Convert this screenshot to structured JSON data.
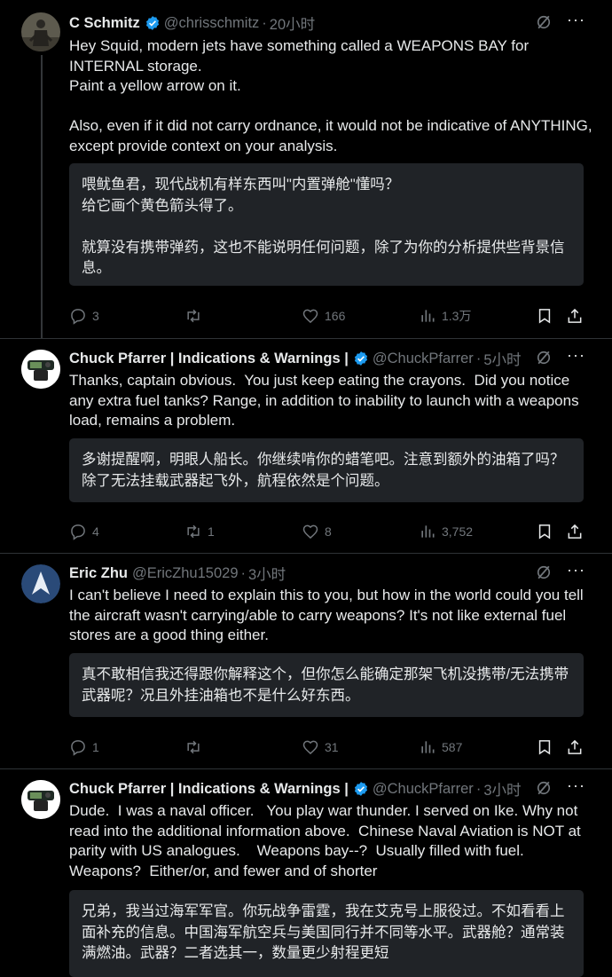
{
  "tweets": [
    {
      "name": "C Schmitz",
      "handle": "@chrisschmitz",
      "time": "20小时",
      "text": "Hey Squid, modern jets have something called a WEAPONS BAY for INTERNAL storage.\nPaint a yellow arrow on it.\n\nAlso, even if it did not carry ordnance, it would not be indicative of ANYTHING, except provide context on your analysis.",
      "translation": "喂鱿鱼君，现代战机有样东西叫\"内置弹舱\"懂吗？\n给它画个黄色箭头得了。\n\n就算没有携带弹药，这也不能说明任何问题，除了为你的分析提供些背景信息。",
      "replies": "3",
      "retweets": "",
      "likes": "166",
      "views": "1.3万"
    },
    {
      "name": "Chuck Pfarrer | Indications & Warnings |",
      "handle": "@ChuckPfarrer",
      "time": "5小时",
      "text": "Thanks, captain obvious.  You just keep eating the crayons.  Did you notice any extra fuel tanks? Range, in addition to inability to launch with a weapons load, remains a problem.",
      "translation": "多谢提醒啊，明眼人船长。你继续啃你的蜡笔吧。注意到额外的油箱了吗？除了无法挂载武器起飞外，航程依然是个问题。",
      "replies": "4",
      "retweets": "1",
      "likes": "8",
      "views": "3,752"
    },
    {
      "name": "Eric Zhu",
      "handle": "@EricZhu15029",
      "time": "3小时",
      "text": "I can't believe I need to explain this to you, but how in the world could you tell the aircraft wasn't carrying/able to carry weapons? It's not like external fuel stores are a good thing either.",
      "translation": "真不敢相信我还得跟你解释这个，但你怎么能确定那架飞机没携带/无法携带武器呢？况且外挂油箱也不是什么好东西。",
      "replies": "1",
      "retweets": "",
      "likes": "31",
      "views": "587"
    },
    {
      "name": "Chuck Pfarrer | Indications & Warnings |",
      "handle": "@ChuckPfarrer",
      "time": "3小时",
      "text": "Dude.  I was a naval officer.   You play war thunder. I served on Ike. Why not read into the additional information above.  Chinese Naval Aviation is NOT at parity with US analogues.    Weapons bay--?  Usually filled with fuel. Weapons?  Either/or, and fewer and of shorter",
      "translation": "兄弟，我当过海军军官。你玩战争雷霆，我在艾克号上服役过。不如看看上面补充的信息。中国海军航空兵与美国同行并不同等水平。武器舱？通常装满燃油。武器？二者选其一，数量更少射程更短"
    }
  ],
  "colors": {
    "background": "#000000",
    "text": "#e7e9ea",
    "muted": "#71767b",
    "verified": "#1d9bf0",
    "translation_box": "#202327"
  },
  "icons": [
    "verified-badge-icon",
    "grok-icon",
    "more-icon",
    "reply-icon",
    "retweet-icon",
    "like-icon",
    "views-icon",
    "bookmark-icon",
    "share-icon"
  ]
}
